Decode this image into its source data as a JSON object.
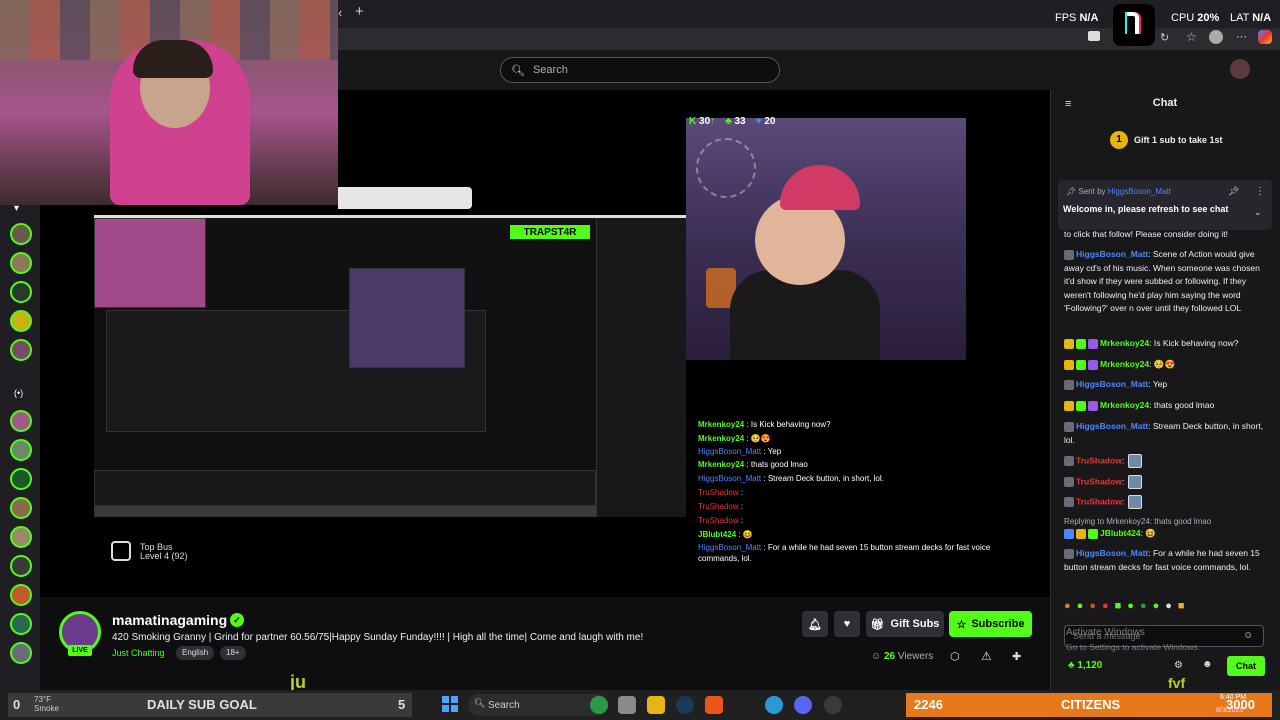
{
  "hud": {
    "fps_label": "FPS",
    "fps_value": "N/A",
    "cpu_label": "CPU",
    "cpu_value": "20%",
    "lat_label": "LAT",
    "lat_value": "N/A"
  },
  "search": {
    "placeholder": "Search"
  },
  "overlay": {
    "stat_a": "30",
    "stat_b": "33",
    "stat_c": "20",
    "inner_logo": "TRAPST4R",
    "bus_title": "Top Bus",
    "bus_level": "Level 4 (92)"
  },
  "stream_chat": [
    {
      "user": "Mrkenkoy24",
      "text": " : Is Kick behaving now?",
      "color": "u"
    },
    {
      "user": "Mrkenkoy24",
      "text": " : 🥺😍",
      "color": "u"
    },
    {
      "user": "HiggsBoson_Matt",
      "text": " : Yep",
      "color": "b"
    },
    {
      "user": "Mrkenkoy24",
      "text": " : thats good lmao",
      "color": "u"
    },
    {
      "user": "HiggsBoson_Matt",
      "text": " : Stream Deck button, in short, lol.",
      "color": "b"
    },
    {
      "user": "TruShadow",
      "text": " :",
      "color": "r"
    },
    {
      "user": "TruShadow",
      "text": " :",
      "color": "r"
    },
    {
      "user": "TruShadow",
      "text": " :",
      "color": "r"
    },
    {
      "user": "JBlubt424",
      "text": " : 😆",
      "color": "u"
    },
    {
      "user": "HiggsBoson_Matt",
      "text": " : For a while he had seven 15 button stream decks for fast voice",
      "color": "b"
    },
    {
      "user": "",
      "text": "commands, lol.",
      "color": "u"
    }
  ],
  "channel": {
    "name": "mamatinagaming",
    "live": "LIVE",
    "title": "420 Smoking Granny | Grind for partner 60.56/75|Happy Sunday Funday!!!! | High all the time| Come and laugh with me!",
    "category": "Just Chatting",
    "tags": [
      "English",
      "18+"
    ],
    "viewers_count": "26",
    "viewers_label": "Viewers"
  },
  "actions": {
    "gift_subs": "Gift Subs",
    "subscribe": "Subscribe"
  },
  "chat": {
    "title": "Chat",
    "gift_prompt": "Gift 1 sub to take 1st",
    "gift_rank": "1",
    "pinned_sent_by": "Sent by",
    "pinned_user": "HiggsBoson_Matt",
    "pinned_msg": "Welcome in, please refresh to see chat",
    "messages": [
      {
        "user": "",
        "text": "to click that follow! Please consider doing it!",
        "color": "#efeff1"
      },
      {
        "user": "HiggsBoson_Matt",
        "text": ": Scene of Action would give away cd's of his music. When someone was chosen it'd show if they were subbed or following. If they weren't following he'd play him saying the word 'Following?' over n over until they followed LOL",
        "color": "#4d88ff"
      },
      {
        "user": "Mrkenkoy24",
        "text": ": Is Kick behaving now?",
        "color": "#53fc18"
      },
      {
        "user": "Mrkenkoy24",
        "text": ": 🥺😍",
        "color": "#53fc18"
      },
      {
        "user": "HiggsBoson_Matt",
        "text": ": Yep",
        "color": "#4d88ff"
      },
      {
        "user": "Mrkenkoy24",
        "text": ": thats good lmao",
        "color": "#53fc18"
      },
      {
        "user": "HiggsBoson_Matt",
        "text": ": Stream Deck button, in short, lol.",
        "color": "#4d88ff"
      },
      {
        "user": "TruShadow",
        "text": ":",
        "color": "#e33"
      },
      {
        "user": "TruShadow",
        "text": ":",
        "color": "#e33"
      },
      {
        "user": "TruShadow",
        "text": ":",
        "color": "#e33"
      }
    ],
    "reply_to": "Replying to Mrkenkoy24: thats good lmao",
    "reply_msg": {
      "user": "JBlubt424",
      "text": ": 😆",
      "color": "#53fc18"
    },
    "last_msg": {
      "user": "HiggsBoson_Matt",
      "text": ": For a while he had seven 15 button stream decks for fast voice commands, lol.",
      "color": "#4d88ff"
    },
    "input_placeholder": "Send a message",
    "watermark_1": "Activate Windows",
    "watermark_2": "Go to Settings to activate Windows.",
    "points": "1,120",
    "send": "Chat"
  },
  "taskbar": {
    "weather_temp": "73°F",
    "weather_desc": "Smoke",
    "goal_left": "0",
    "goal_label": "DAILY SUB GOAL",
    "goal_right": "5",
    "search": "Search",
    "citizens_left": "2246",
    "citizens_label": "CITIZENS",
    "citizens_right": "3000",
    "time": "6:40 PM",
    "date": "8/3/2025"
  },
  "colors": {
    "kick_green": "#53fc18",
    "link_blue": "#4d88ff",
    "citizens_orange": "#e8791a"
  }
}
